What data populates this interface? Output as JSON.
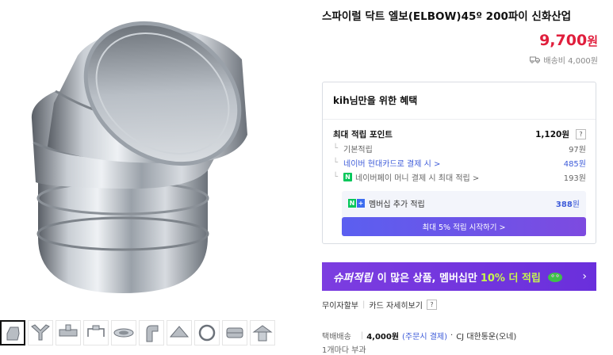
{
  "product": {
    "title": "스파이럴 닥트 엘보(ELBOW)45º 200파이 신화산업",
    "price": "9,700",
    "price_unit": "원",
    "shipping_fee_label": "배송비 4,000원"
  },
  "benefits": {
    "title": "kih님만을 위한 혜택",
    "max_points_label": "최대 적립 포인트",
    "max_points_value": "1,120원",
    "help_mark": "?",
    "rows": [
      {
        "label": "기본적립",
        "value": "97원"
      },
      {
        "label": "네이버 현대카드로 결제 시 >",
        "value": "485원"
      },
      {
        "label": "네이버페이 머니 결제 시 최대 적립 >",
        "value": "193원",
        "badge": "N"
      }
    ],
    "membership": {
      "badge_n": "N",
      "badge_plus": "+",
      "label": "멤버십 추가 적립",
      "value": "388",
      "value_unit": "원",
      "button_label": "최대 5% 적립 시작하기 >"
    }
  },
  "banner": {
    "brand": "슈퍼적립",
    "text": "이 많은 상품, 멤버십만",
    "highlight": "10% 더 적립",
    "chevron": "›"
  },
  "installment": {
    "label": "무이자할부",
    "separator": "|",
    "card_link": "카드 자세히보기",
    "help_mark": "?"
  },
  "delivery": {
    "label": "택배배송",
    "separator": "|",
    "fee": "4,000원",
    "pay_type": "(주문시 결제)",
    "dot": "·",
    "carrier": "CJ 대한통운(오네)",
    "per_item": "1개마다 부과"
  },
  "colors": {
    "price_red": "#e01e3c",
    "link_blue": "#3d5bd9",
    "banner_purple": "#7c3de0",
    "banner_highlight": "#c6f64e",
    "naver_green": "#03c75a"
  }
}
